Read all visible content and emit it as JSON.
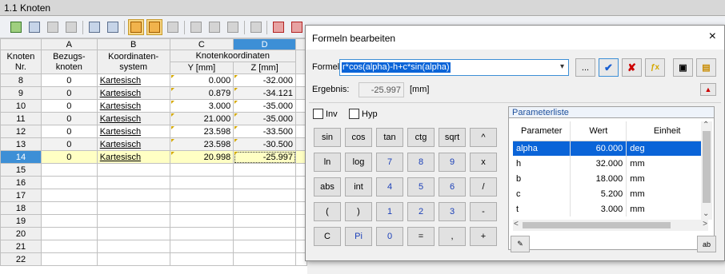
{
  "window": {
    "title": "1.1 Knoten"
  },
  "grid": {
    "letters": [
      "A",
      "B",
      "C",
      "D"
    ],
    "header1": [
      "Knoten",
      "Bezugs-",
      "Koordinaten-",
      "Knotenkoordinaten"
    ],
    "header2": [
      "Nr.",
      "knoten",
      "system",
      "Y [mm]",
      "Z [mm]"
    ],
    "rows": [
      {
        "nr": "8",
        "ref": "0",
        "sys": "Kartesisch",
        "y": "0.000",
        "z": "-32.000"
      },
      {
        "nr": "9",
        "ref": "0",
        "sys": "Kartesisch",
        "y": "0.879",
        "z": "-34.121"
      },
      {
        "nr": "10",
        "ref": "0",
        "sys": "Kartesisch",
        "y": "3.000",
        "z": "-35.000"
      },
      {
        "nr": "11",
        "ref": "0",
        "sys": "Kartesisch",
        "y": "21.000",
        "z": "-35.000"
      },
      {
        "nr": "12",
        "ref": "0",
        "sys": "Kartesisch",
        "y": "23.598",
        "z": "-33.500"
      },
      {
        "nr": "13",
        "ref": "0",
        "sys": "Kartesisch",
        "y": "23.598",
        "z": "-30.500"
      },
      {
        "nr": "14",
        "ref": "0",
        "sys": "Kartesisch",
        "y": "20.998",
        "z": "-25.997"
      },
      {
        "nr": "15",
        "ref": "",
        "sys": "",
        "y": "",
        "z": ""
      },
      {
        "nr": "16",
        "ref": "",
        "sys": "",
        "y": "",
        "z": ""
      },
      {
        "nr": "17",
        "ref": "",
        "sys": "",
        "y": "",
        "z": ""
      },
      {
        "nr": "18",
        "ref": "",
        "sys": "",
        "y": "",
        "z": ""
      },
      {
        "nr": "19",
        "ref": "",
        "sys": "",
        "y": "",
        "z": ""
      },
      {
        "nr": "20",
        "ref": "",
        "sys": "",
        "y": "",
        "z": ""
      },
      {
        "nr": "21",
        "ref": "",
        "sys": "",
        "y": "",
        "z": ""
      },
      {
        "nr": "22",
        "ref": "",
        "sys": "",
        "y": "",
        "z": ""
      }
    ]
  },
  "dialog": {
    "title": "Formeln bearbeiten",
    "close": "×",
    "formula_label": "Formel:",
    "formula_value": "r*cos(alpha)-h+c*sin(alpha)",
    "browse_label": "...",
    "result_label": "Ergebnis:",
    "result_value": "-25.997",
    "result_unit": "[mm]",
    "inv_label": "Inv",
    "hyp_label": "Hyp",
    "keys": [
      [
        "sin",
        "cos",
        "tan",
        "ctg",
        "sqrt",
        "^"
      ],
      [
        "ln",
        "log",
        "7",
        "8",
        "9",
        "x"
      ],
      [
        "abs",
        "int",
        "4",
        "5",
        "6",
        "/"
      ],
      [
        "(",
        ")",
        "1",
        "2",
        "3",
        "-"
      ],
      [
        "C",
        "Pi",
        "0",
        "=",
        ",",
        "+"
      ]
    ],
    "param_title": "Parameterliste",
    "param_headers": [
      "Parameter",
      "Wert",
      "Einheit"
    ],
    "params": [
      {
        "name": "alpha",
        "value": "60.000",
        "unit": "deg"
      },
      {
        "name": "h",
        "value": "32.000",
        "unit": "mm"
      },
      {
        "name": "b",
        "value": "18.000",
        "unit": "mm"
      },
      {
        "name": "c",
        "value": "5.200",
        "unit": "mm"
      },
      {
        "name": "t",
        "value": "3.000",
        "unit": "mm"
      }
    ]
  },
  "colors": {
    "selection": "#0a64d8",
    "column_highlight": "#3d8fd6",
    "row_highlight": "#ffffc4"
  }
}
